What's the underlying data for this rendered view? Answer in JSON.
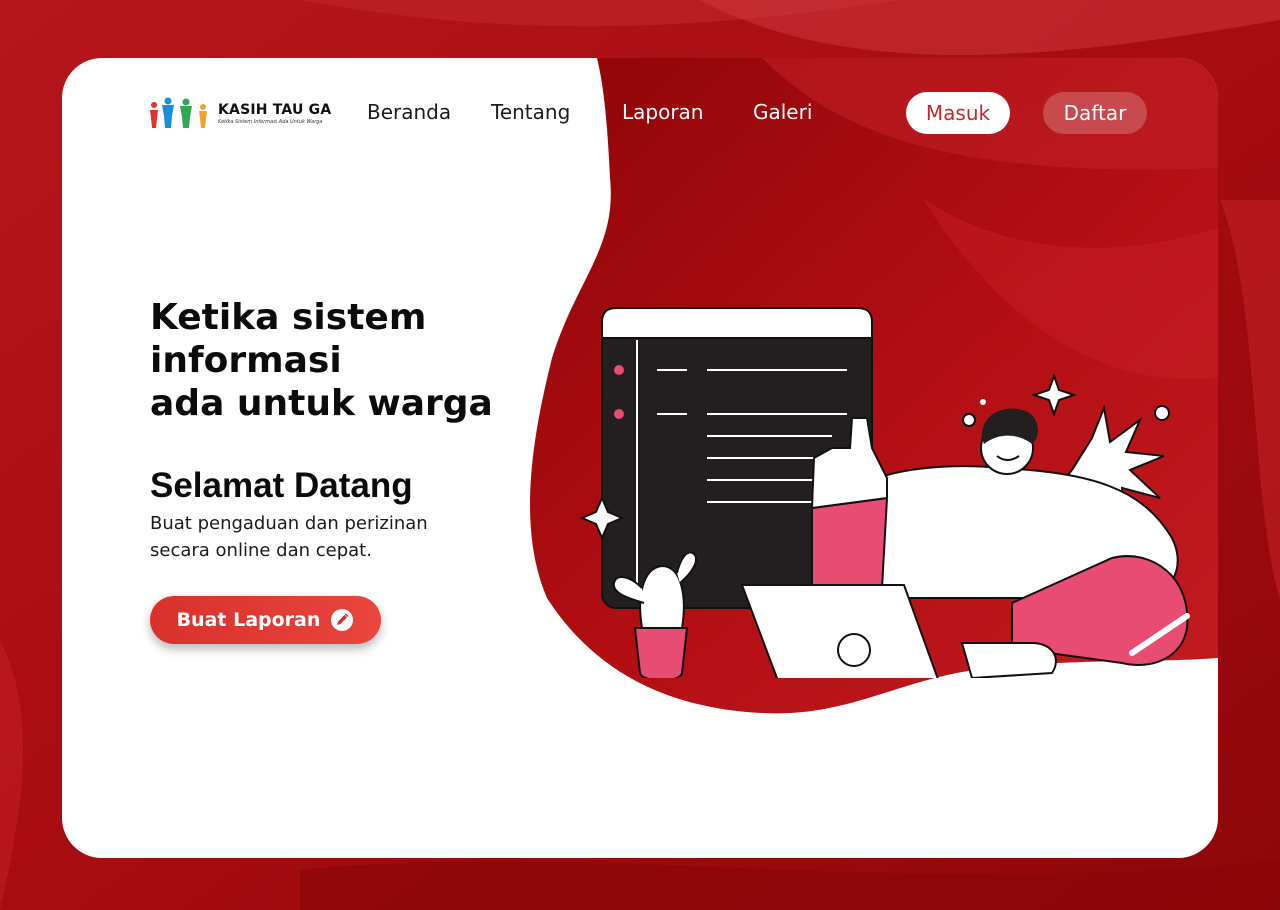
{
  "brand": {
    "name": "KASIH TAU GA",
    "tagline": "Ketika Sistem Informasi Ada Untuk Warga"
  },
  "nav": {
    "items": [
      "Beranda",
      "Tentang",
      "Laporan",
      "Galeri"
    ],
    "login_label": "Masuk",
    "register_label": "Daftar"
  },
  "hero": {
    "title_lines": [
      "Ketika sistem",
      "informasi",
      "ada untuk warga"
    ],
    "welcome": "Selamat Datang",
    "subtitle_lines": [
      "Buat pengaduan dan perizinan",
      "secara online dan cepat."
    ],
    "cta_label": "Buat Laporan",
    "cta_icon": "pencil-icon"
  },
  "colors": {
    "brand_red": "#c9262c",
    "background_red": "#a50d10",
    "accent_pink": "#e84c73",
    "card_white": "#ffffff"
  }
}
